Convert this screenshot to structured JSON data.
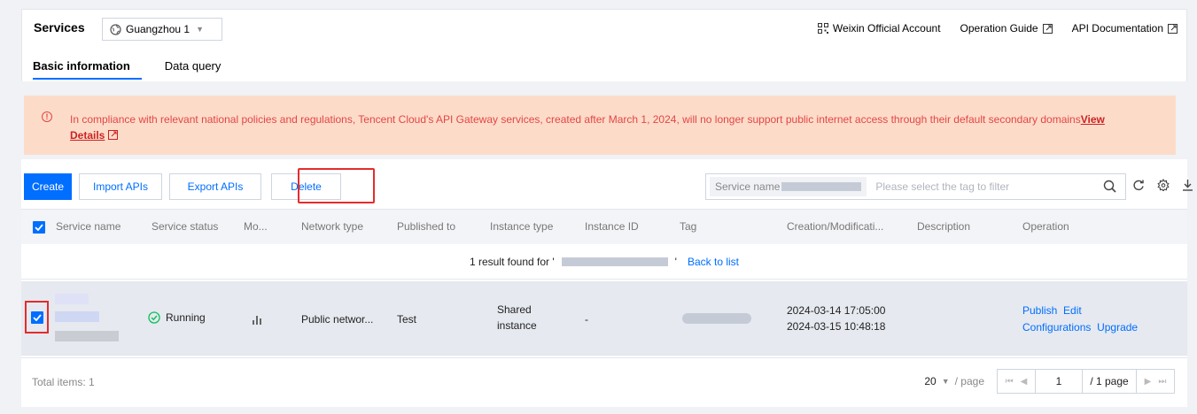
{
  "header": {
    "title": "Services",
    "region": "Guangzhou 1",
    "links": {
      "weixin": "Weixin Official Account",
      "guide": "Operation Guide",
      "api_doc": "API Documentation"
    },
    "tabs": [
      "Basic information",
      "Data query"
    ]
  },
  "notice": {
    "text": "In compliance with relevant national policies and regulations, Tencent Cloud's API Gateway services, created after March 1, 2024, will no longer support public internet access through their default secondary domains",
    "link1": "View",
    "link2": "Details"
  },
  "toolbar": {
    "create": "Create",
    "import": "Import APIs",
    "export": "Export APIs",
    "delete": "Delete",
    "search_chip": "Service name",
    "tag_placeholder": "Please select the tag to filter"
  },
  "table": {
    "columns": [
      "Service name",
      "Service status",
      "Mo...",
      "Network type",
      "Published to",
      "Instance type",
      "Instance ID",
      "Tag",
      "Creation/Modificati...",
      "Description",
      "Operation"
    ],
    "result_prefix": "1 result found for '",
    "result_suffix": "'",
    "back_link": "Back to list",
    "row": {
      "status": "Running",
      "network": "Public networ...",
      "published": "Test",
      "instance_type_1": "Shared",
      "instance_type_2": "instance",
      "instance_id": "-",
      "created": "2024-03-14 17:05:00",
      "modified": "2024-03-15 10:48:18",
      "ops": [
        "Publish",
        "Edit",
        "Configurations",
        "Upgrade"
      ]
    }
  },
  "footer": {
    "total": "Total items: 1",
    "page_size": "20",
    "per_page": "/ page",
    "page": "1",
    "page_total": "/ 1 page"
  },
  "colors": {
    "accent": "#006eff",
    "warning_bg": "#fcdcc9",
    "warning_text": "#e54545",
    "highlight": "#e42c2c",
    "success": "#0abf5b"
  }
}
